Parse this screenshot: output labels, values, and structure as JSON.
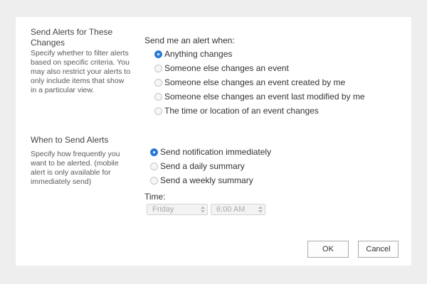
{
  "alerts_section": {
    "title": "Send Alerts for These Changes",
    "description": "Specify whether to filter alerts based on specific criteria. You may also restrict your alerts to only include items that show in a particular view.",
    "prompt": "Send me an alert when:",
    "options": [
      {
        "label": "Anything changes",
        "checked": true
      },
      {
        "label": "Someone else changes an event",
        "checked": false
      },
      {
        "label": "Someone else changes an event created by me",
        "checked": false
      },
      {
        "label": "Someone else changes an event last modified by me",
        "checked": false
      },
      {
        "label": "The time or location of an event changes",
        "checked": false
      }
    ]
  },
  "when_section": {
    "title": "When to Send Alerts",
    "description": "Specify how frequently you want to be alerted. (mobile alert is only available for immediately send)",
    "options": [
      {
        "label": "Send notification immediately",
        "checked": true
      },
      {
        "label": "Send a daily summary",
        "checked": false
      },
      {
        "label": "Send a weekly summary",
        "checked": false
      }
    ],
    "time_label": "Time:",
    "day_select": {
      "value": "Friday",
      "disabled": true
    },
    "time_select": {
      "value": "6:00 AM",
      "disabled": true
    }
  },
  "buttons": {
    "ok": "OK",
    "cancel": "Cancel"
  },
  "colors": {
    "accent": "#2a7ad6",
    "background": "#eeeeee",
    "panel": "#ffffff"
  }
}
